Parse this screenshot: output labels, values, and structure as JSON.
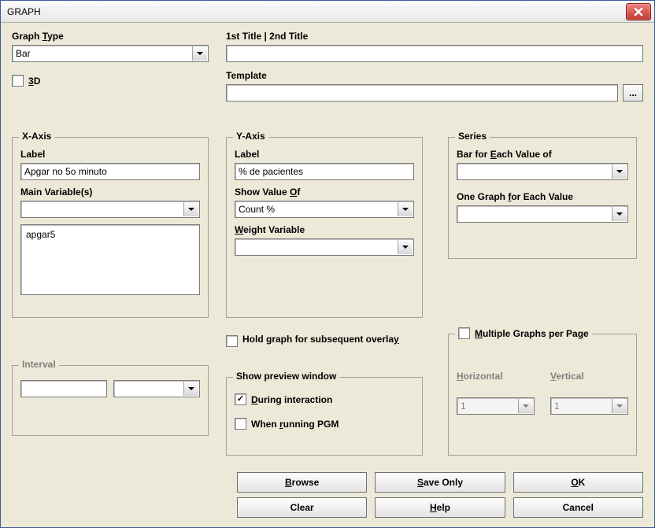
{
  "window": {
    "title": "GRAPH"
  },
  "graph_type": {
    "label_pre": "Graph ",
    "label_u": "T",
    "label_post": "ype",
    "value": "Bar"
  },
  "titles": {
    "label": "1st Title | 2nd Title",
    "value": ""
  },
  "template": {
    "label": "Template",
    "value": "",
    "browse_label": "..."
  },
  "three_d": {
    "u": "3",
    "post": "D",
    "checked": false
  },
  "xaxis": {
    "legend": "X-Axis",
    "label_label": "Label",
    "label_value": "Apgar no 5o minuto",
    "mainvar_label": "Main Variable(s)",
    "mainvar_value": "",
    "list_item": "apgar5"
  },
  "yaxis": {
    "legend": "Y-Axis",
    "label_label": "Label",
    "label_value": "% de pacientes",
    "show_pre": "Show Value ",
    "show_u": "O",
    "show_post": "f",
    "show_value": "Count %",
    "weight_pre": "",
    "weight_u": "W",
    "weight_post": "eight Variable",
    "weight_value": ""
  },
  "series": {
    "legend": "Series",
    "barfor_pre": "Bar for ",
    "barfor_u": "E",
    "barfor_post": "ach Value of",
    "barfor_value": "",
    "onegraph_pre": "One Graph ",
    "onegraph_u": "f",
    "onegraph_post": "or Each Value",
    "onegraph_value": ""
  },
  "interval": {
    "legend": "Interval",
    "value1": "",
    "value2": ""
  },
  "hold": {
    "pre": "Hold graph for subsequent overla",
    "u": "y",
    "post": "",
    "checked": false
  },
  "preview": {
    "legend": "Show preview window",
    "during_pre": "",
    "during_u": "D",
    "during_post": "uring interaction",
    "during_checked": true,
    "pgm_pre": "When ",
    "pgm_u": "r",
    "pgm_post": "unning PGM",
    "pgm_checked": false
  },
  "mgp": {
    "pre": "",
    "u": "M",
    "post": "ultiple Graphs per Page",
    "checked": false,
    "h_pre": "",
    "h_u": "H",
    "h_post": "orizontal",
    "h_value": "1",
    "v_pre": "",
    "v_u": "V",
    "v_post": "ertical",
    "v_value": "1"
  },
  "buttons": {
    "browse_pre": "",
    "browse_u": "B",
    "browse_post": "rowse",
    "saveonly_pre": "",
    "saveonly_u": "S",
    "saveonly_post": "ave Only",
    "ok_pre": "",
    "ok_u": "O",
    "ok_post": "K",
    "clear": "Clear",
    "help_pre": "",
    "help_u": "H",
    "help_post": "elp",
    "cancel": "Cancel"
  }
}
